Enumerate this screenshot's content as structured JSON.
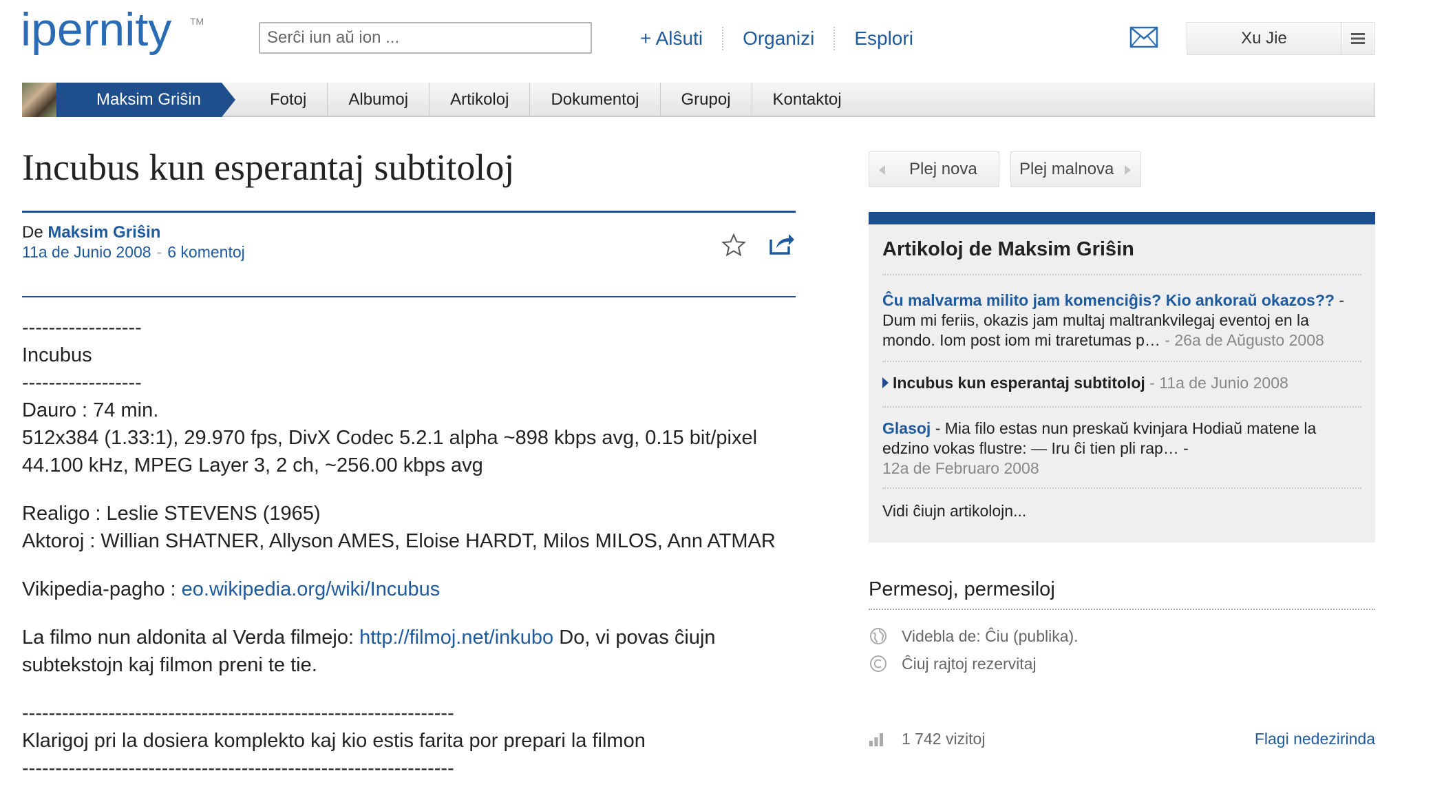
{
  "header": {
    "logo_text": "ipernity",
    "logo_tm": "TM",
    "search_placeholder": "Serĉi iun aŭ ion ...",
    "nav": [
      "+ Alŝuti",
      "Organizi",
      "Esplori"
    ],
    "user_name": "Xu Jie"
  },
  "profile_bar": {
    "name": "Maksim Griŝin",
    "tabs": [
      "Fotoj",
      "Albumoj",
      "Artikoloj",
      "Dokumentoj",
      "Grupoj",
      "Kontaktoj"
    ]
  },
  "article": {
    "title": "Incubus kun esperantaj subtitoloj",
    "by_prefix": "De",
    "author": "Maksim Griŝin",
    "date": "11a de Junio 2008",
    "date_sep": "-",
    "comments": "6 komentoj",
    "lines": {
      "l1": "------------------",
      "l2": "Incubus",
      "l3": "------------------",
      "l4": "Dauro : 74 min.",
      "l5": "512x384 (1.33:1), 29.970 fps, DivX Codec 5.2.1 alpha ~898 kbps avg, 0.15 bit/pixel",
      "l6": "44.100 kHz, MPEG Layer 3, 2 ch, ~256.00 kbps avg",
      "l7": "Realigo : Leslie STEVENS (1965)",
      "l8": "Aktoroj : Willian SHATNER, Allyson AMES, Eloise HARDT, Milos MILOS, Ann ATMAR",
      "l9_label": "Vikipedia-pagho : ",
      "l9_link": "eo.wikipedia.org/wiki/Incubus",
      "l10_pre": "La filmo nun aldonita al Verda filmejo: ",
      "l10_link": "http://filmoj.net/inkubo",
      "l10_post": " Do, vi povas ĉiujn subtekstojn kaj filmon preni te tie.",
      "l11": "-----------------------------------------------------------------",
      "l12": "Klarigoj pri la dosiera komplekto kaj kio estis farita por prepari la filmon",
      "l13": "-----------------------------------------------------------------"
    }
  },
  "sidebar": {
    "prev": "Plej nova",
    "next": "Plej malnova",
    "box_title": "Artikoloj de Maksim Griŝin",
    "items": [
      {
        "title": "Ĉu malvarma milito jam komenciĝis? Kio ankoraŭ okazos??",
        "excerpt": " - Dum mi feriis, okazis jam multaj maltrankvilegaj eventoj en la mondo. Iom post iom mi traretumas p…",
        "date": " - 26a de Aŭgusto 2008"
      },
      {
        "title": "Incubus kun esperantaj subtitoloj",
        "date": " - 11a de Junio 2008"
      },
      {
        "title": "Glasoj",
        "excerpt": " - Mia filo estas nun preskaŭ kvinjara Hodiaŭ matene la edzino vokas flustre: — Iru ĉi tien pli rap… -",
        "date": "12a de Februaro 2008"
      }
    ],
    "see_all": "Vidi ĉiujn artikolojn...",
    "perm_title": "Permesoj, permesiloj",
    "visibility": "Videbla de: Ĉiu (publika).",
    "rights": "Ĉiuj rajtoj rezervitaj",
    "visits": "1 742 vizitoj",
    "flag": "Flagi nedezirinda"
  },
  "colors": {
    "brand_blue": "#1e4e8c",
    "link_blue": "#1e5a9e",
    "logo_blue": "#2a6bb5"
  },
  "icons": [
    "mail-icon",
    "menu-icon",
    "star-icon",
    "share-icon",
    "globe-icon",
    "copyright-icon",
    "stats-icon"
  ]
}
